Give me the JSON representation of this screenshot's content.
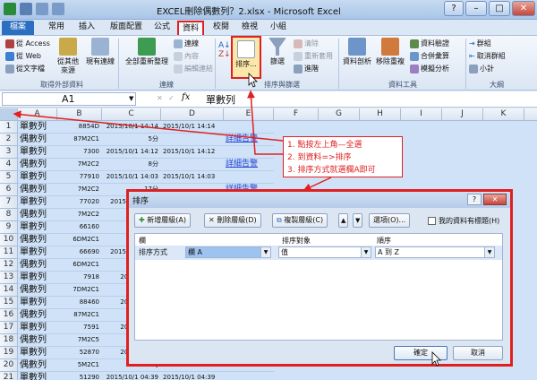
{
  "window": {
    "title": "EXCEL刪除偶數列？2.xlsx - Microsoft Excel",
    "controls": [
      "?",
      "–",
      "□",
      "✕"
    ]
  },
  "tabs": {
    "file": "檔案",
    "items": [
      "常用",
      "插入",
      "版面配置",
      "公式",
      "資料",
      "校閱",
      "檢視",
      "小組"
    ]
  },
  "ribbon": {
    "external": {
      "access": "從 Access",
      "web": "從 Web",
      "text": "從文字檔",
      "other_1": "從其他",
      "other_2": "來源",
      "existing": "現有連線",
      "label": "取得外部資料"
    },
    "connections": {
      "refresh": "全部重新整理",
      "conn": "連線",
      "props": "內容",
      "edit_links": "編輯連結",
      "label": "連線"
    },
    "sort_filter": {
      "sort": "排序...",
      "filter": "篩選",
      "clear": "清除",
      "reapply": "重新套用",
      "advanced": "進階",
      "label": "排序與篩選"
    },
    "data_tools": {
      "text_to_cols": "資料剖析",
      "remove_dup": "移除重複",
      "validation": "資料驗證",
      "consolidate": "合併彙算",
      "what_if": "模擬分析",
      "label": "資料工具"
    },
    "outline": {
      "group": "群組",
      "ungroup": "取消群組",
      "subtotal": "小計",
      "label": "大綱"
    }
  },
  "formula_bar": {
    "name_box": "A1",
    "fx": "fx",
    "value": "單數列"
  },
  "grid": {
    "columns": [
      "A",
      "B",
      "C",
      "D",
      "E",
      "F",
      "G",
      "H",
      "I",
      "J",
      "K",
      "L",
      "M"
    ],
    "rows": [
      {
        "n": "1",
        "a": "單數列",
        "b": "8854D",
        "c": "2015/10/1 14:14",
        "d": "2015/10/1 14:14",
        "e": ""
      },
      {
        "n": "2",
        "a": "偶數列",
        "b": "87M2C1",
        "c": "5分",
        "d": "",
        "e": "詳細告警"
      },
      {
        "n": "3",
        "a": "單數列",
        "b": "7300",
        "c": "2015/10/1 14:12",
        "d": "2015/10/1 14:12",
        "e": ""
      },
      {
        "n": "4",
        "a": "偶數列",
        "b": "7M2C2",
        "c": "8分",
        "d": "",
        "e": "詳細告警"
      },
      {
        "n": "5",
        "a": "單數列",
        "b": "77910",
        "c": "2015/10/1 14:03",
        "d": "2015/10/1 14:03",
        "e": ""
      },
      {
        "n": "6",
        "a": "偶數列",
        "b": "7M2C2",
        "c": "17分",
        "d": "",
        "e": "詳細告警"
      },
      {
        "n": "7",
        "a": "單數列",
        "b": "77020",
        "c": "2015/10/1 14:0",
        "d": "",
        "e": ""
      },
      {
        "n": "8",
        "a": "偶數列",
        "b": "7M2C2",
        "c": "1",
        "d": "",
        "e": ""
      },
      {
        "n": "9",
        "a": "單數列",
        "b": "66160",
        "c": "2015/10/1",
        "d": "",
        "e": ""
      },
      {
        "n": "10",
        "a": "偶數列",
        "b": "6DM2C1",
        "c": "01時1",
        "d": "",
        "e": ""
      },
      {
        "n": "11",
        "a": "單數列",
        "b": "66690",
        "c": "2015/10/1 13:5",
        "d": "",
        "e": ""
      },
      {
        "n": "12",
        "a": "偶數列",
        "b": "6DM2C1",
        "c": "01時",
        "d": "",
        "e": ""
      },
      {
        "n": "13",
        "a": "單數列",
        "b": "7918",
        "c": "2015/10/1 1",
        "d": "",
        "e": ""
      },
      {
        "n": "14",
        "a": "偶數列",
        "b": "7DM2C1",
        "c": "03時3",
        "d": "",
        "e": ""
      },
      {
        "n": "15",
        "a": "單數列",
        "b": "88460",
        "c": "2015/10/1 1",
        "d": "",
        "e": ""
      },
      {
        "n": "16",
        "a": "偶數列",
        "b": "87M2C1",
        "c": "01時",
        "d": "",
        "e": ""
      },
      {
        "n": "17",
        "a": "單數列",
        "b": "7591",
        "c": "2015/10/1 1",
        "d": "",
        "e": ""
      },
      {
        "n": "18",
        "a": "偶數列",
        "b": "7M2C5",
        "c": "04時0",
        "d": "",
        "e": ""
      },
      {
        "n": "19",
        "a": "單數列",
        "b": "52870",
        "c": "2015/10/1 1",
        "d": "",
        "e": ""
      },
      {
        "n": "20",
        "a": "偶數列",
        "b": "5M2C1",
        "c": "04時",
        "d": "",
        "e": ""
      },
      {
        "n": "21",
        "a": "單數列",
        "b": "51290",
        "c": "2015/10/1 04:39",
        "d": "2015/10/1 04:39",
        "e": ""
      }
    ]
  },
  "annotation": {
    "line1": "1. 點按左上角—全選",
    "line2": "2. 到資料=>排序",
    "line3": "3. 排序方式就選欄A即可"
  },
  "dialog": {
    "title": "排序",
    "add": "新增層級(A)",
    "delete": "刪除層級(D)",
    "copy": "複製層級(C)",
    "options": "選項(O)...",
    "has_header": "我的資料有標題(H)",
    "col_header": "欄",
    "sort_on_header": "排序對象",
    "order_header": "順序",
    "row_label": "排序方式",
    "column_value": "欄 A",
    "sort_on_value": "值",
    "order_value": "A 到 Z",
    "ok": "確定",
    "cancel": "取消"
  },
  "colors": {
    "accent_red": "#e02020",
    "file_tab": "#2a6fc0",
    "selection": "#cfe2f8"
  }
}
